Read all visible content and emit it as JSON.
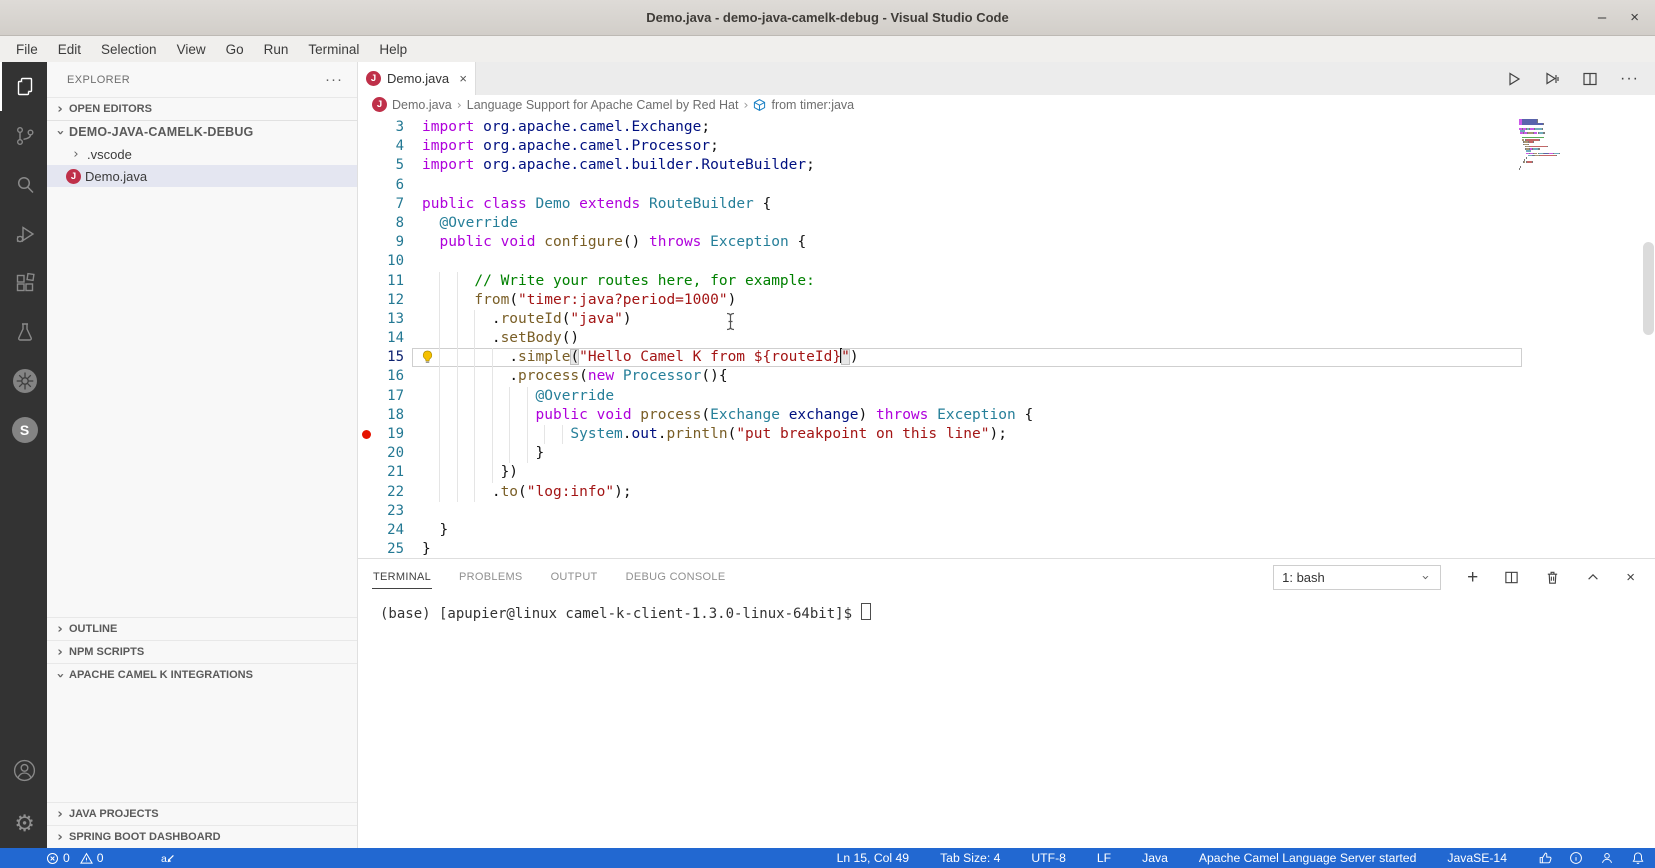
{
  "window": {
    "title": "Demo.java - demo-java-camelk-debug - Visual Studio Code",
    "minimize_glyph": "–",
    "close_glyph": "×"
  },
  "menu": {
    "items": [
      "File",
      "Edit",
      "Selection",
      "View",
      "Go",
      "Run",
      "Terminal",
      "Help"
    ]
  },
  "activity_bar": {
    "icons": [
      "explorer-icon",
      "source-control-icon",
      "search-icon",
      "run-debug-icon",
      "extensions-icon",
      "test-beaker-icon",
      "kubernetes-icon",
      "camel-k-icon",
      "account-icon",
      "settings-gear-icon"
    ],
    "camel_k_letter": "S"
  },
  "sidebar": {
    "title": "EXPLORER",
    "more_glyph": "···",
    "open_editors": "OPEN EDITORS",
    "root": "DEMO-JAVA-CAMELK-DEBUG",
    "tree": [
      {
        "label": ".vscode",
        "type": "folder"
      },
      {
        "label": "Demo.java",
        "type": "java",
        "selected": true,
        "icon_letter": "J"
      }
    ],
    "bottom_sections": [
      {
        "label": "OUTLINE",
        "expanded": false
      },
      {
        "label": "NPM SCRIPTS",
        "expanded": false
      },
      {
        "label": "APACHE CAMEL K INTEGRATIONS",
        "expanded": true
      }
    ],
    "footer_sections": [
      {
        "label": "JAVA PROJECTS"
      },
      {
        "label": "SPRING BOOT DASHBOARD"
      }
    ]
  },
  "editor": {
    "tab": {
      "label": "Demo.java",
      "close_glyph": "×",
      "icon_letter": "J"
    },
    "breadcrumb": [
      {
        "label": "Demo.java"
      },
      {
        "label": "Language Support for Apache Camel by Red Hat"
      },
      {
        "label": "from timer:java"
      }
    ],
    "toolbar_more_glyph": "···",
    "current_line": 15,
    "cursor": {
      "line": 15,
      "col": 49
    },
    "breakpoint_line": 19,
    "lightbulb_line": 15,
    "lines": [
      {
        "n": 3,
        "indent": 0,
        "tokens": [
          [
            "kw",
            "import"
          ],
          [
            "pkg",
            " org.apache.camel.Exchange"
          ],
          [
            "pl",
            ";"
          ]
        ]
      },
      {
        "n": 4,
        "indent": 0,
        "tokens": [
          [
            "kw",
            "import"
          ],
          [
            "pkg",
            " org.apache.camel.Processor"
          ],
          [
            "pl",
            ";"
          ]
        ]
      },
      {
        "n": 5,
        "indent": 0,
        "tokens": [
          [
            "kw",
            "import"
          ],
          [
            "pkg",
            " org.apache.camel.builder.RouteBuilder"
          ],
          [
            "pl",
            ";"
          ]
        ]
      },
      {
        "n": 6,
        "indent": 0,
        "tokens": []
      },
      {
        "n": 7,
        "indent": 0,
        "tokens": [
          [
            "kw",
            "public"
          ],
          [
            "pl",
            " "
          ],
          [
            "kw",
            "class"
          ],
          [
            "pl",
            " "
          ],
          [
            "cls",
            "Demo"
          ],
          [
            "pl",
            " "
          ],
          [
            "kw",
            "extends"
          ],
          [
            "pl",
            " "
          ],
          [
            "cls",
            "RouteBuilder"
          ],
          [
            "pl",
            " {"
          ]
        ]
      },
      {
        "n": 8,
        "indent": 2,
        "tokens": [
          [
            "ann",
            "@Override"
          ]
        ]
      },
      {
        "n": 9,
        "indent": 2,
        "tokens": [
          [
            "kw",
            "public"
          ],
          [
            "pl",
            " "
          ],
          [
            "kw",
            "void"
          ],
          [
            "pl",
            " "
          ],
          [
            "fn",
            "configure"
          ],
          [
            "pl",
            "() "
          ],
          [
            "kw",
            "throws"
          ],
          [
            "pl",
            " "
          ],
          [
            "cls",
            "Exception"
          ],
          [
            "pl",
            " {"
          ]
        ]
      },
      {
        "n": 10,
        "indent": 0,
        "tokens": []
      },
      {
        "n": 11,
        "indent": 6,
        "tokens": [
          [
            "com",
            "// Write your routes here, for example:"
          ]
        ]
      },
      {
        "n": 12,
        "indent": 6,
        "tokens": [
          [
            "fn",
            "from"
          ],
          [
            "pl",
            "("
          ],
          [
            "str",
            "\"timer:java?period=1000\""
          ],
          [
            "pl",
            ")"
          ]
        ]
      },
      {
        "n": 13,
        "indent": 8,
        "tokens": [
          [
            "pl",
            "."
          ],
          [
            "fn",
            "routeId"
          ],
          [
            "pl",
            "("
          ],
          [
            "str",
            "\"java\""
          ],
          [
            "pl",
            ")"
          ]
        ]
      },
      {
        "n": 14,
        "indent": 8,
        "tokens": [
          [
            "pl",
            "."
          ],
          [
            "fn",
            "setBody"
          ],
          [
            "pl",
            "()"
          ]
        ]
      },
      {
        "n": 15,
        "indent": 10,
        "tokens": [
          [
            "pl",
            "."
          ],
          [
            "fn",
            "simple"
          ],
          [
            "pl bm",
            "("
          ],
          [
            "str",
            "\"Hello Camel K from ${routeId}"
          ],
          [
            "caret",
            ""
          ],
          [
            "str bm",
            "\""
          ],
          [
            "pl",
            ")"
          ]
        ]
      },
      {
        "n": 16,
        "indent": 10,
        "tokens": [
          [
            "pl",
            "."
          ],
          [
            "fn",
            "process"
          ],
          [
            "pl",
            "("
          ],
          [
            "kw",
            "new"
          ],
          [
            "pl",
            " "
          ],
          [
            "cls",
            "Processor"
          ],
          [
            "pl",
            "(){"
          ]
        ]
      },
      {
        "n": 17,
        "indent": 13,
        "tokens": [
          [
            "ann",
            "@Override"
          ]
        ]
      },
      {
        "n": 18,
        "indent": 13,
        "tokens": [
          [
            "kw",
            "public"
          ],
          [
            "pl",
            " "
          ],
          [
            "kw",
            "void"
          ],
          [
            "pl",
            " "
          ],
          [
            "fn",
            "process"
          ],
          [
            "pl",
            "("
          ],
          [
            "cls",
            "Exchange"
          ],
          [
            "pl",
            " "
          ],
          [
            "var",
            "exchange"
          ],
          [
            "pl",
            ") "
          ],
          [
            "kw",
            "throws"
          ],
          [
            "pl",
            " "
          ],
          [
            "cls",
            "Exception"
          ],
          [
            "pl",
            " {"
          ]
        ]
      },
      {
        "n": 19,
        "indent": 17,
        "tokens": [
          [
            "cls",
            "System"
          ],
          [
            "pl",
            "."
          ],
          [
            "var",
            "out"
          ],
          [
            "pl",
            "."
          ],
          [
            "fn",
            "println"
          ],
          [
            "pl",
            "("
          ],
          [
            "str",
            "\"put breakpoint on this line\""
          ],
          [
            "pl",
            ");"
          ]
        ]
      },
      {
        "n": 20,
        "indent": 13,
        "tokens": [
          [
            "pl",
            "}"
          ]
        ]
      },
      {
        "n": 21,
        "indent": 9,
        "tokens": [
          [
            "pl",
            "})"
          ]
        ]
      },
      {
        "n": 22,
        "indent": 8,
        "tokens": [
          [
            "pl",
            "."
          ],
          [
            "fn",
            "to"
          ],
          [
            "pl",
            "("
          ],
          [
            "str",
            "\"log:info\""
          ],
          [
            "pl",
            ");"
          ]
        ]
      },
      {
        "n": 23,
        "indent": 0,
        "tokens": []
      },
      {
        "n": 24,
        "indent": 2,
        "tokens": [
          [
            "pl",
            "}"
          ]
        ]
      },
      {
        "n": 25,
        "indent": 0,
        "tokens": [
          [
            "pl",
            "}"
          ]
        ]
      }
    ]
  },
  "panel": {
    "tabs": [
      {
        "label": "TERMINAL",
        "active": true
      },
      {
        "label": "PROBLEMS",
        "active": false
      },
      {
        "label": "OUTPUT",
        "active": false
      },
      {
        "label": "DEBUG CONSOLE",
        "active": false
      }
    ],
    "terminal_select": "1: bash",
    "plus_glyph": "+",
    "close_glyph": "×",
    "prompt": "(base) [apupier@linux camel-k-client-1.3.0-linux-64bit]$"
  },
  "status_bar": {
    "errors": "0",
    "warnings": "0",
    "right": [
      "Ln 15, Col 49",
      "Tab Size: 4",
      "UTF-8",
      "LF",
      "Java",
      "Apache Camel Language Server started",
      "JavaSE-14"
    ],
    "right_icons": [
      "thumbs-up-icon",
      "info-icon",
      "feedback-icon",
      "bell-icon"
    ]
  },
  "colors": {
    "status_bar": "#2268d1",
    "activity_bar": "#333333",
    "breakpoint": "#e51400",
    "java_icon": "#bf3049",
    "token_keyword": "#AF00DB",
    "token_class": "#267F99",
    "token_function": "#795E26",
    "token_string": "#A31515",
    "token_comment": "#008000",
    "token_variable": "#001080"
  }
}
